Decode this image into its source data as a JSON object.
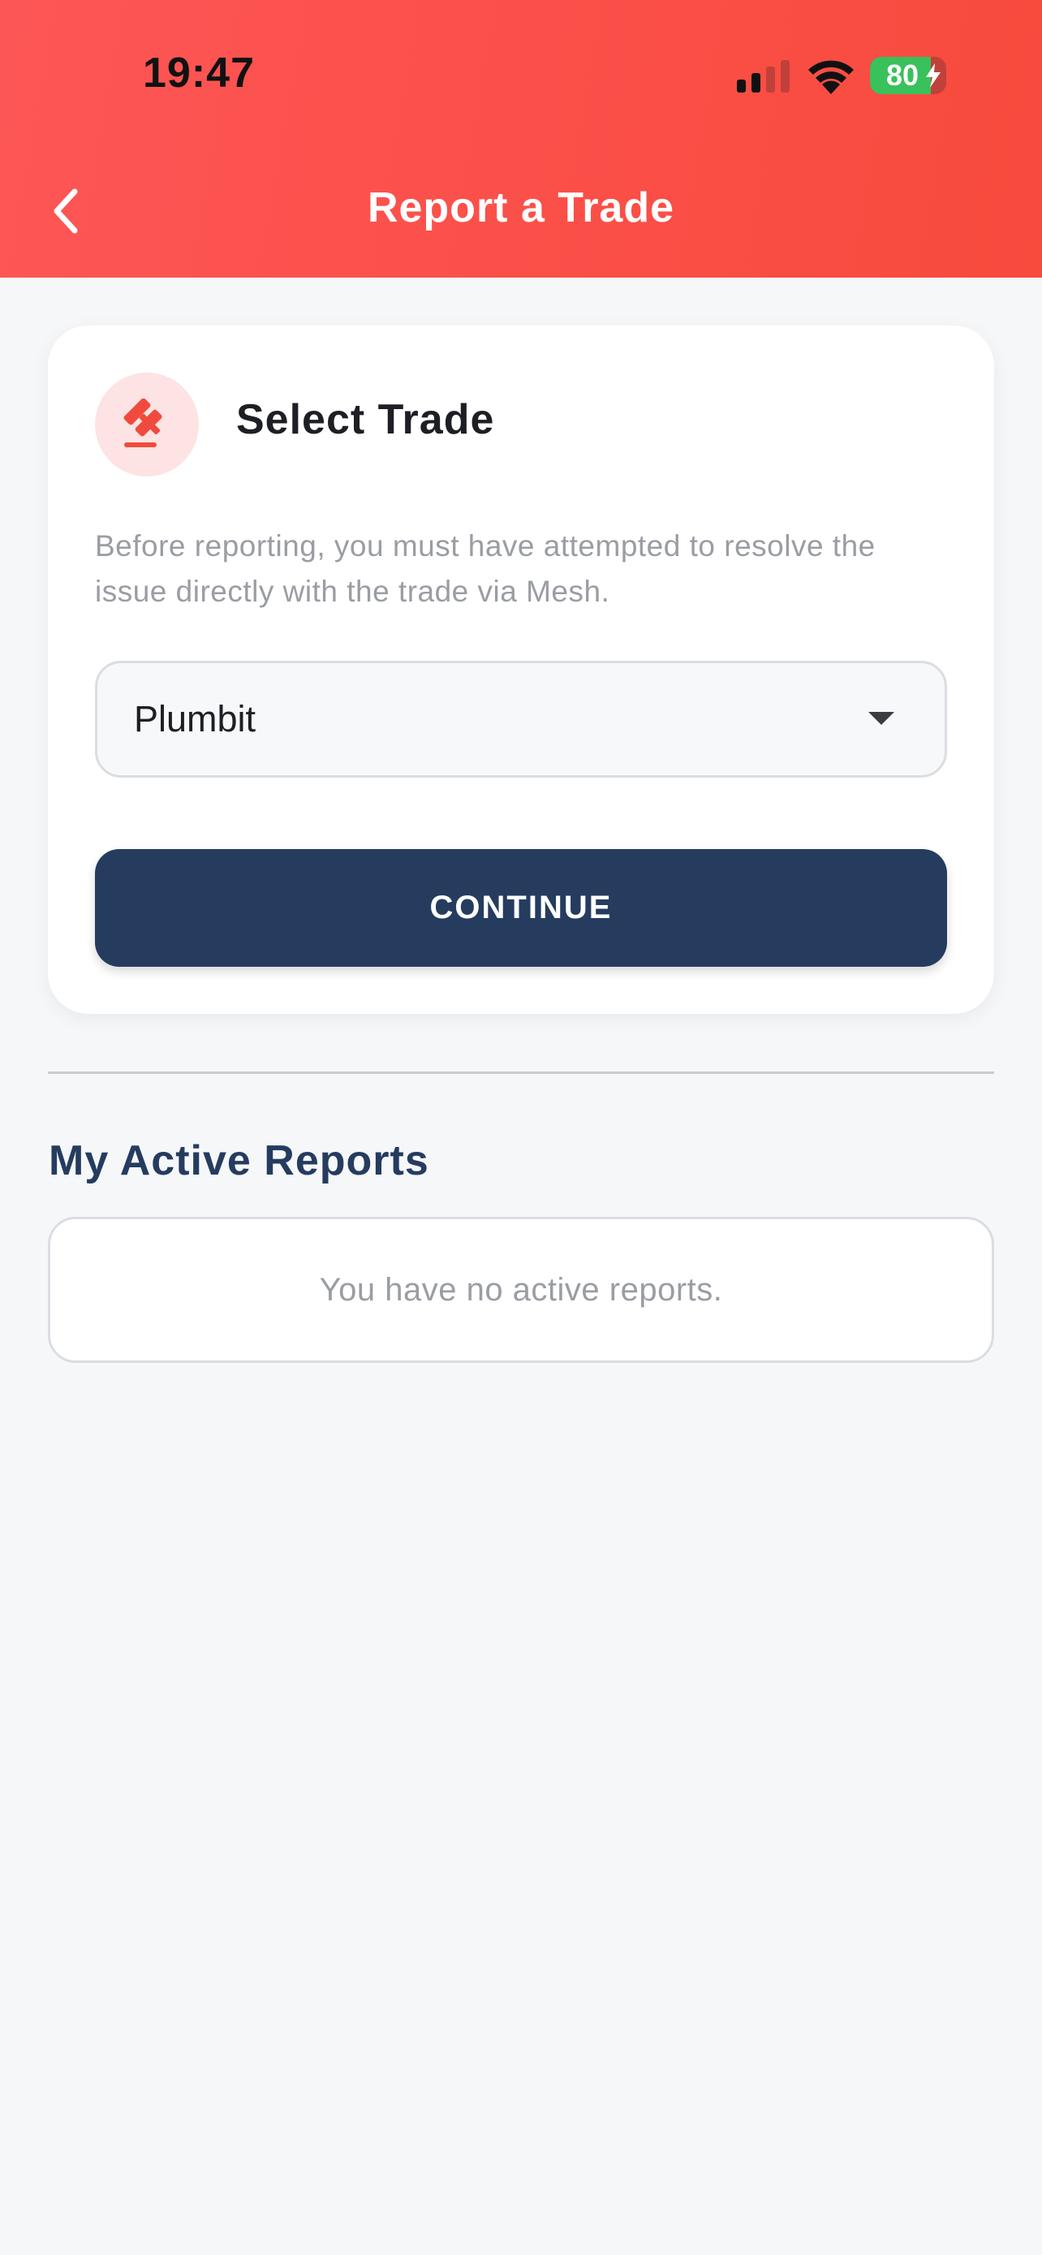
{
  "status_bar": {
    "time": "19:47",
    "battery_level": "80",
    "signal_icon": "cellular-signal-icon",
    "wifi_icon": "wifi-icon",
    "battery_icon": "battery-charging-icon"
  },
  "header": {
    "title": "Report a Trade",
    "back_icon": "chevron-left-icon"
  },
  "select_card": {
    "icon": "gavel-icon",
    "title": "Select Trade",
    "description": "Before reporting, you must have attempted to resolve the issue directly with the trade via Mesh.",
    "selected_trade": "Plumbit",
    "dropdown_icon": "caret-down-icon",
    "continue_label": "CONTINUE"
  },
  "active_reports": {
    "title": "My Active Reports",
    "empty_message": "You have no active reports."
  },
  "colors": {
    "header_gradient_start": "#fd5656",
    "header_gradient_end": "#f84a3d",
    "primary_navy": "#253c5f",
    "accent_red": "#f04a3e",
    "battery_green": "#39c15b"
  }
}
